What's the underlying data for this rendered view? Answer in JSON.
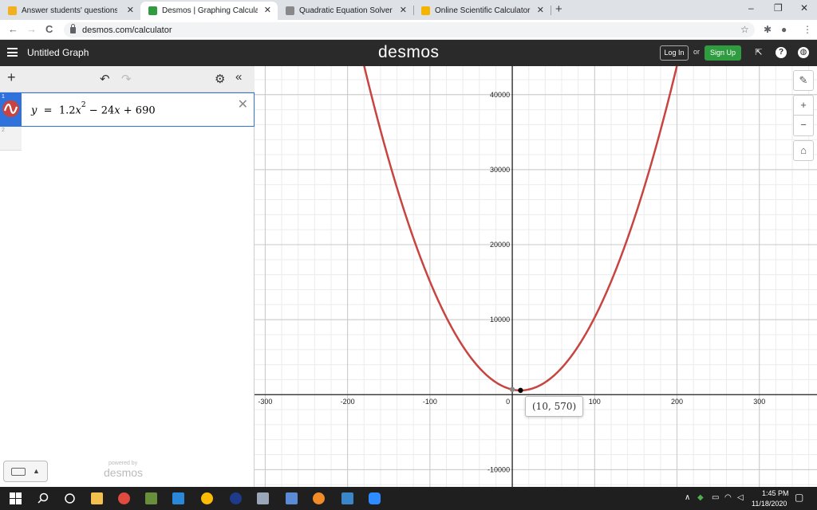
{
  "browser": {
    "tabs": [
      {
        "label": "Answer students' questions and ...",
        "favicon_color": "#f2b01e",
        "active": false
      },
      {
        "label": "Desmos | Graphing Calculator",
        "favicon_color": "#2f9c3f",
        "active": true
      },
      {
        "label": "Quadratic Equation Solver",
        "favicon_color": "#888888",
        "active": false
      },
      {
        "label": "Online Scientific Calculator",
        "favicon_color": "#f4b400",
        "active": false
      }
    ],
    "new_tab": "+",
    "window_controls": {
      "minimize": "–",
      "restore": "❐",
      "close": "✕"
    },
    "url": "desmos.com/calculator",
    "nav": {
      "back": "←",
      "forward": "→",
      "reload": "C"
    }
  },
  "header": {
    "graph_title": "Untitled Graph",
    "logo": "desmos",
    "login_label": "Log In",
    "or_label": "or",
    "signup_label": "Sign Up",
    "signup_color": "#2f9c3f"
  },
  "expressions": {
    "toolbar": {
      "add": "+",
      "undo": "↶",
      "redo": "↷",
      "settings": "⚙",
      "collapse": "«"
    },
    "items": [
      {
        "index": "1",
        "lhs": "y",
        "coef": "1.2",
        "var": "x",
        "exp": "2",
        "mid": "− 24",
        "var2": "x",
        "tail": "+ 690",
        "color": "#c74440"
      },
      {
        "index": "2"
      }
    ],
    "powered_by": "powered by",
    "powered_logo": "desmos"
  },
  "graph": {
    "controls": {
      "wrench": "🔧",
      "zoom_in": "+",
      "zoom_out": "−",
      "home": "⌂"
    },
    "point_label": "(10, 570)"
  },
  "chart_data": {
    "type": "line",
    "title": "",
    "xlabel": "",
    "ylabel": "",
    "xlim": [
      -313,
      370
    ],
    "ylim": [
      -12300,
      43800
    ],
    "x_ticks": [
      -300,
      -200,
      -100,
      100,
      200,
      300
    ],
    "x_tick_labels": [
      "-300",
      "-200",
      "-100",
      "100",
      "200",
      "300"
    ],
    "y_ticks": [
      -10000,
      10000,
      20000,
      30000,
      40000
    ],
    "y_tick_labels": [
      "-10000",
      "10000",
      "20000",
      "30000",
      "40000"
    ],
    "origin_label": "0",
    "grid": true,
    "series": [
      {
        "expression": "1.2x^2 - 24x + 690",
        "a": 1.2,
        "b": -24,
        "c": 690,
        "color": "#c74440"
      }
    ],
    "points": [
      {
        "x": 10,
        "y": 570,
        "color": "#000000"
      },
      {
        "x": 0,
        "y": 690,
        "color": "#888888"
      }
    ]
  },
  "taskbar": {
    "time": "1:45 PM",
    "date": "11/18/2020"
  }
}
